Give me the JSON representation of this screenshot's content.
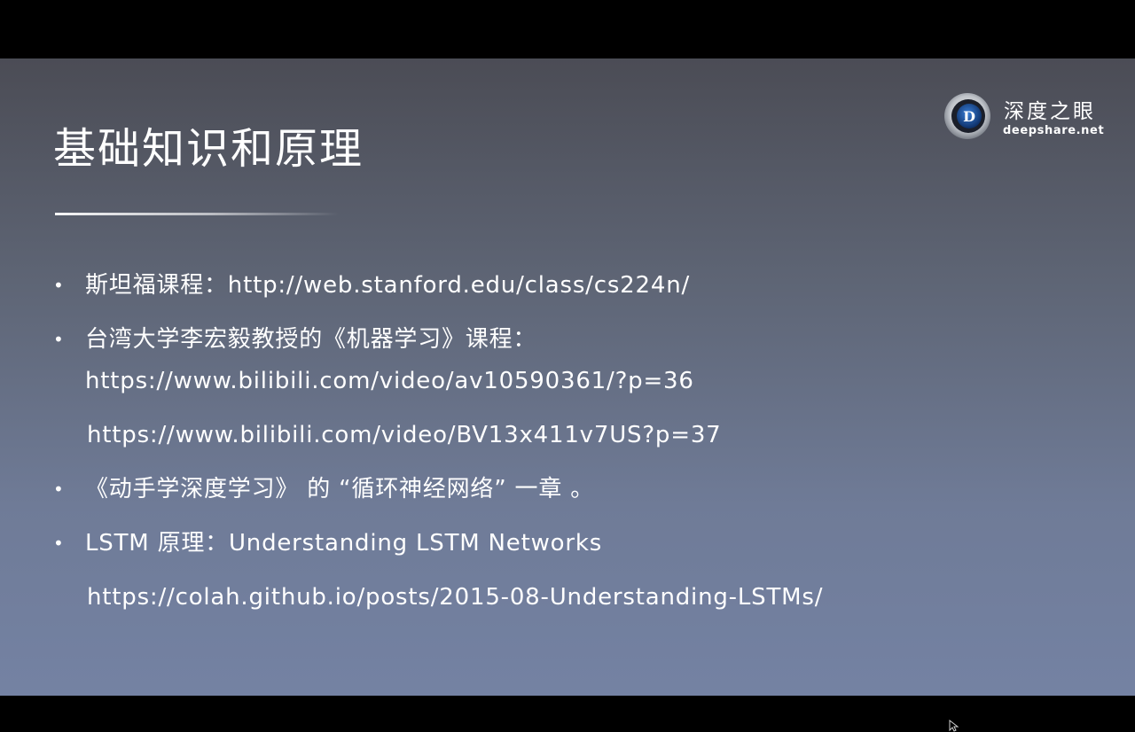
{
  "slide": {
    "title": "基础知识和原理",
    "logo": {
      "chinese": "深度之眼",
      "site": "deepshare.net",
      "emblem_letter": "D"
    },
    "bullet_char": "•",
    "items": [
      {
        "lines": [
          "斯坦福课程：http://web.stanford.edu/class/cs224n/"
        ]
      },
      {
        "lines": [
          "台湾大学李宏毅教授的《机器学习》课程：",
          "https://www.bilibili.com/video/av10590361/?p=36",
          "https://www.bilibili.com/video/BV13x411v7US?p=37"
        ]
      },
      {
        "lines": [
          "《动手学深度学习》 的 “循环神经网络” 一章 。"
        ]
      },
      {
        "lines": [
          "LSTM 原理：Understanding LSTM Networks",
          "https://colah.github.io/posts/2015-08-Understanding-LSTMs/"
        ]
      }
    ]
  },
  "colors": {
    "letterbox": "#000000",
    "slide_top": "#4b4c55",
    "slide_bottom": "#7482a3",
    "text": "#ffffff",
    "logo_blue": "#1a4fa0"
  }
}
